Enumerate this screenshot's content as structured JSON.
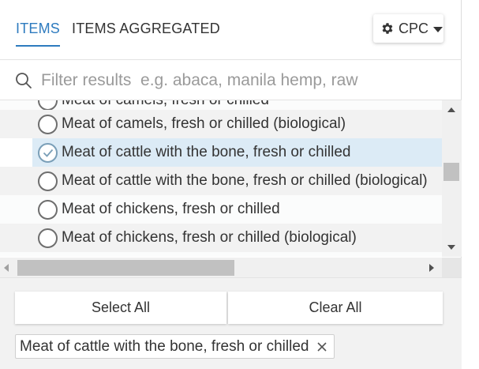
{
  "tabs": [
    {
      "label": "ITEMS",
      "active": true
    },
    {
      "label": "ITEMS AGGREGATED",
      "active": false
    }
  ],
  "classification": {
    "label": "CPC",
    "icon": "gear-icon"
  },
  "search": {
    "placeholder": "Filter results  e.g. abaca, manila hemp, raw",
    "value": ""
  },
  "list": {
    "partial_top": "Meat of camels, fresh or chilled",
    "items": [
      {
        "label": "Meat of camels, fresh or chilled (biological)",
        "selected": false
      },
      {
        "label": "Meat of cattle with the bone, fresh or chilled",
        "selected": true
      },
      {
        "label": "Meat of cattle with the bone, fresh or chilled (biological)",
        "selected": false
      },
      {
        "label": "Meat of chickens, fresh or chilled",
        "selected": false
      },
      {
        "label": "Meat of chickens, fresh or chilled (biological)",
        "selected": false
      }
    ]
  },
  "buttons": {
    "select_all": "Select All",
    "clear_all": "Clear All"
  },
  "selected_chips": [
    "Meat of cattle with the bone, fresh or chilled"
  ],
  "colors": {
    "accent": "#2e7bbf",
    "selected_row": "#dcebf6"
  }
}
